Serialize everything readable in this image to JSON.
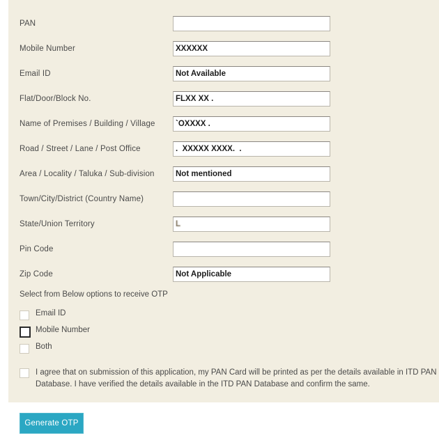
{
  "panel": {
    "background_color": "#f2eee1"
  },
  "form": {
    "fields": [
      {
        "label": "PAN",
        "value": "",
        "state": "redacted"
      },
      {
        "label": "Mobile Number",
        "value": "XXXXXX",
        "state": "normal"
      },
      {
        "label": "Email ID",
        "value": "Not Available",
        "state": "normal"
      },
      {
        "label": "Flat/Door/Block No.",
        "value": "FLXX XX .",
        "state": "semi"
      },
      {
        "label": "Name of Premises / Building / Village",
        "value": "`OXXXX .",
        "state": "semi"
      },
      {
        "label": "Road / Street / Lane / Post Office",
        "value": ".  XXXXX XXXX.  .",
        "state": "semi"
      },
      {
        "label": "Area / Locality / Taluka / Sub-division",
        "value": "Not mentioned",
        "state": "normal"
      },
      {
        "label": "Town/City/District (Country Name)",
        "value": "",
        "state": "redacted"
      },
      {
        "label": "State/Union Territory",
        "value": "L",
        "state": "faint"
      },
      {
        "label": "Pin Code",
        "value": "",
        "state": "redacted"
      },
      {
        "label": "Zip Code",
        "value": "Not Applicable",
        "state": "normal"
      }
    ]
  },
  "otp": {
    "prompt": "Select from Below options to receive OTP",
    "options": [
      {
        "label": "Email ID",
        "checked": false,
        "focused": false
      },
      {
        "label": "Mobile Number",
        "checked": false,
        "focused": true
      },
      {
        "label": "Both",
        "checked": false,
        "focused": false
      }
    ]
  },
  "agreement": {
    "checked": false,
    "text": "I agree that on submission of this application, my PAN Card will be printed as per the details available in ITD PAN Database. I have verified the details available in the ITD PAN Database and confirm the same."
  },
  "actions": {
    "generate_otp_label": "Generate OTP",
    "accent_color": "#2ba7c3"
  }
}
